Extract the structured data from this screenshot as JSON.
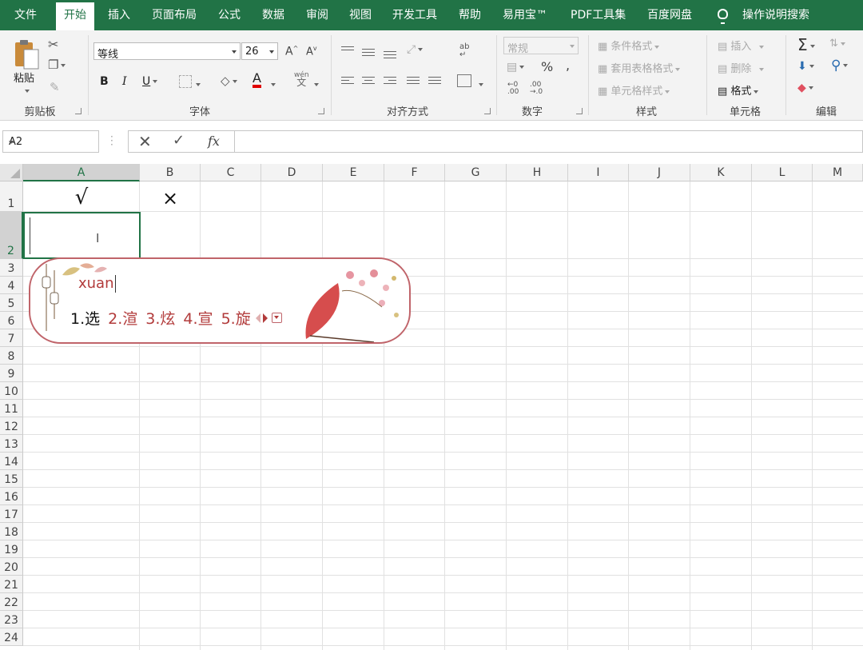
{
  "menu": {
    "tabs": [
      {
        "label": "文件"
      },
      {
        "label": "开始"
      },
      {
        "label": "插入"
      },
      {
        "label": "页面布局"
      },
      {
        "label": "公式"
      },
      {
        "label": "数据"
      },
      {
        "label": "审阅"
      },
      {
        "label": "视图"
      },
      {
        "label": "开发工具"
      },
      {
        "label": "帮助"
      },
      {
        "label": "易用宝™"
      },
      {
        "label": "PDF工具集"
      },
      {
        "label": "百度网盘"
      }
    ],
    "search": "操作说明搜索"
  },
  "ribbon": {
    "clipboard": {
      "label": "剪贴板",
      "paste": "粘贴"
    },
    "font": {
      "label": "字体",
      "name": "等线",
      "size": "26",
      "bold": "B",
      "italic": "I",
      "underline": "U",
      "grow": "A",
      "shrink": "A",
      "color_a": "A",
      "phonetic": "wén",
      "phonetic_char": "文"
    },
    "alignment": {
      "label": "对齐方式",
      "wrap_icon": "ab"
    },
    "number": {
      "label": "数字",
      "format": "常规",
      "percent": "%",
      "comma": ","
    },
    "styles": {
      "label": "样式",
      "conditional": "条件格式",
      "table": "套用表格格式",
      "cell": "单元格样式"
    },
    "cells": {
      "label": "单元格",
      "insert": "插入",
      "delete": "删除",
      "format": "格式"
    },
    "editing": {
      "label": "编辑",
      "sum": "Σ"
    }
  },
  "formula_bar": {
    "name_box": "A2",
    "fx": "fx",
    "value": ""
  },
  "columns": [
    "A",
    "B",
    "C",
    "D",
    "E",
    "F",
    "G",
    "H",
    "I",
    "J",
    "K",
    "L",
    "M"
  ],
  "rows": [
    "1",
    "2",
    "3",
    "4",
    "5",
    "6",
    "7",
    "8",
    "9",
    "10",
    "11",
    "12",
    "13",
    "14",
    "15",
    "16",
    "17",
    "18",
    "19",
    "20",
    "21",
    "22",
    "23",
    "24"
  ],
  "cells": {
    "A1": "√",
    "B1": "×"
  },
  "ime": {
    "composition": "xuan",
    "candidates": [
      "1.选",
      "2.渲",
      "3.炫",
      "4.宣",
      "5.旋"
    ]
  },
  "colors": {
    "accent": "#217346",
    "ime_text": "#b23b3b",
    "ime_border": "#c0646a"
  }
}
